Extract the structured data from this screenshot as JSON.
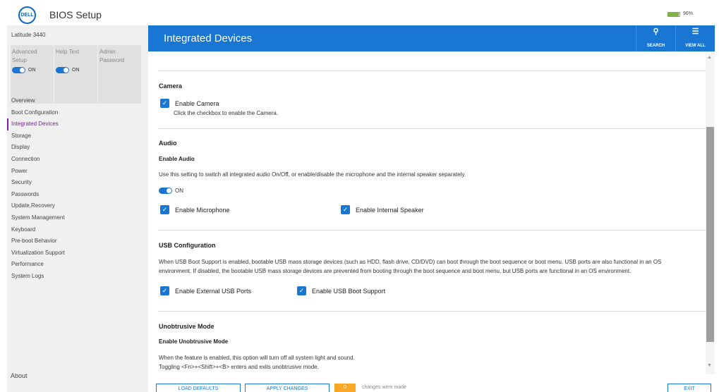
{
  "app": {
    "logo_text": "DELL",
    "title": "BIOS Setup",
    "battery_level": 96,
    "battery_text": "96%",
    "accent_color": "#1976d2"
  },
  "sidebar": {
    "model": "Latitude 3440",
    "tiles": [
      {
        "label": "Advanced Setup",
        "toggle": "ON",
        "has_toggle": true
      },
      {
        "label": "Help Text",
        "toggle": "ON",
        "has_toggle": true
      },
      {
        "label": "Admin Password",
        "has_toggle": false
      }
    ],
    "items": [
      {
        "label": "Overview"
      },
      {
        "label": "Boot Configuration"
      },
      {
        "label": "Integrated Devices",
        "active": true
      },
      {
        "label": "Storage"
      },
      {
        "label": "Display"
      },
      {
        "label": "Connection"
      },
      {
        "label": "Power"
      },
      {
        "label": "Security"
      },
      {
        "label": "Passwords"
      },
      {
        "label": "Update,Recovery"
      },
      {
        "label": "System Management"
      },
      {
        "label": "Keyboard"
      },
      {
        "label": "Pre-boot Behavior"
      },
      {
        "label": "Virtualization Support"
      },
      {
        "label": "Performance"
      },
      {
        "label": "System Logs"
      }
    ],
    "about": "About"
  },
  "header": {
    "title": "Integrated Devices",
    "search_label": "SEARCH",
    "search_icon": "search-icon",
    "view_all_label": "VIEW ALL",
    "view_all_icon": "tree-icon"
  },
  "camera": {
    "title": "Camera",
    "checkbox_label": "Enable Camera",
    "hint": "Click the checkbox to enable the Camera.",
    "checked": true
  },
  "audio": {
    "title": "Audio",
    "subtitle": "Enable Audio",
    "description": "Use this setting to switch all integrated audio On/Off, or enable/disable the microphone and the internal speaker separately.",
    "toggle": "ON",
    "mic_label": "Enable Microphone",
    "speaker_label": "Enable Internal Speaker"
  },
  "usb": {
    "title": "USB Configuration",
    "description": "When USB Boot Support is enabled, bootable USB mass storage devices (such as HDD, flash drive, CD/DVD) can boot through the boot sequence or boot menu. USB ports are also functional in an OS environment. If disabled, the bootable USB mass storage devices are prevented from booting through the boot sequence and boot menu, but USB ports are functional in an OS environment.",
    "external_label": "Enable External USB Ports",
    "boot_label": "Enable USB Boot Support"
  },
  "unobtrusive": {
    "title": "Unobtrusive Mode",
    "subtitle": "Enable Unobtrusive Mode",
    "line1": "When the feature is enabled, this option will turn off all system light and sound.",
    "line2": "Toggling <Fn>+<Shift>+<B> enters and exits unobtrusive mode."
  },
  "footer": {
    "load_defaults": "LOAD DEFAULTS",
    "apply_changes": "APPLY CHANGES",
    "changes_count": "0",
    "changes_text": "changes were made",
    "exit": "EXIT"
  }
}
